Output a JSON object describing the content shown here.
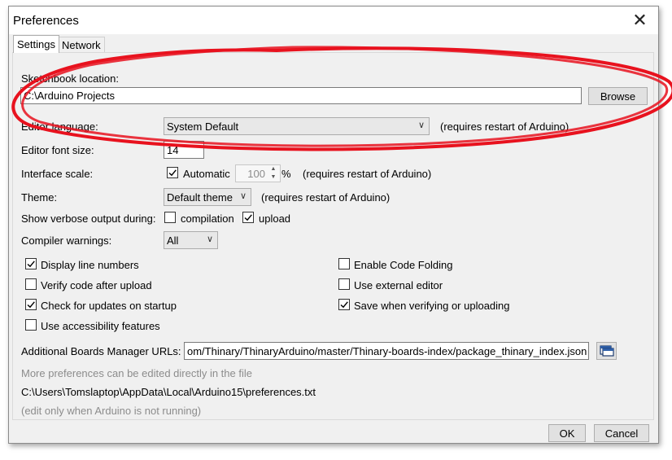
{
  "window": {
    "title": "Preferences"
  },
  "tabs": [
    {
      "label": "Settings",
      "active": true
    },
    {
      "label": "Network",
      "active": false
    }
  ],
  "sketchbook": {
    "label": "Sketchbook location:",
    "value": "C:\\Arduino Projects",
    "browse_label": "Browse"
  },
  "editor_language": {
    "label": "Editor language:",
    "value": "System Default",
    "note": "(requires restart of Arduino)"
  },
  "font_size": {
    "label": "Editor font size:",
    "value": "14"
  },
  "interface_scale": {
    "label": "Interface scale:",
    "automatic_label": "Automatic",
    "automatic_checked": true,
    "value": "100",
    "unit": "%",
    "note": "(requires restart of Arduino)"
  },
  "theme": {
    "label": "Theme:",
    "value": "Default theme",
    "note": "(requires restart of Arduino)"
  },
  "verbose": {
    "label": "Show verbose output during:",
    "compilation_label": "compilation",
    "compilation_checked": false,
    "upload_label": "upload",
    "upload_checked": true
  },
  "compiler_warnings": {
    "label": "Compiler warnings:",
    "value": "All"
  },
  "options_left": [
    {
      "label": "Display line numbers",
      "checked": true
    },
    {
      "label": "Verify code after upload",
      "checked": false
    },
    {
      "label": "Check for updates on startup",
      "checked": true
    },
    {
      "label": "Use accessibility features",
      "checked": false
    }
  ],
  "options_right": [
    {
      "label": "Enable Code Folding",
      "checked": false
    },
    {
      "label": "Use external editor",
      "checked": false
    },
    {
      "label": "Save when verifying or uploading",
      "checked": true
    }
  ],
  "boards_urls": {
    "label": "Additional Boards Manager URLs:",
    "value": "om/Thinary/ThinaryArduino/master/Thinary-boards-index/package_thinary_index.json"
  },
  "footer": {
    "more_prefs": "More preferences can be edited directly in the file",
    "prefs_path": "C:\\Users\\Tomslaptop\\AppData\\Local\\Arduino15\\preferences.txt",
    "edit_note": "(edit only when Arduino is not running)"
  },
  "buttons": {
    "ok": "OK",
    "cancel": "Cancel"
  },
  "colors": {
    "annotation": "#e8121e",
    "window_bg": "#f0f0f0"
  },
  "icons": {
    "close": "close-icon",
    "check": "checkmark-icon",
    "dropdown": "chevron-down-icon",
    "edit_list": "window-list-icon"
  }
}
